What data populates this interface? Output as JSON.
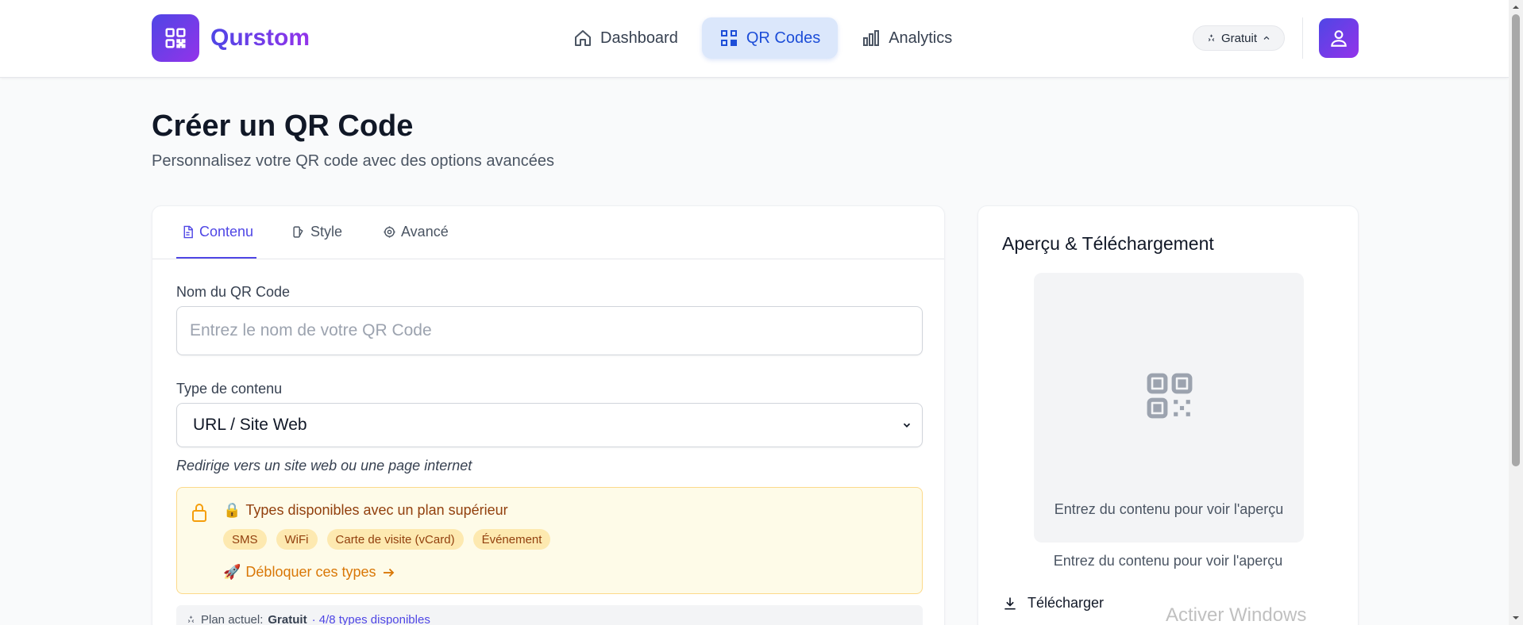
{
  "app": {
    "name": "Qurstom"
  },
  "nav": {
    "items": [
      {
        "label": "Dashboard",
        "icon": "home-icon"
      },
      {
        "label": "QR Codes",
        "icon": "qr-code-icon"
      },
      {
        "label": "Analytics",
        "icon": "bar-chart-icon"
      }
    ],
    "active": "QR Codes"
  },
  "header": {
    "plan_label": "Gratuit"
  },
  "page": {
    "title": "Créer un QR Code",
    "subtitle": "Personnalisez votre QR code avec des options avancées"
  },
  "tabs": [
    {
      "label": "Contenu",
      "icon": "file-icon"
    },
    {
      "label": "Style",
      "icon": "palette-icon"
    },
    {
      "label": "Avancé",
      "icon": "gear-icon"
    }
  ],
  "form": {
    "name_label": "Nom du QR Code",
    "name_placeholder": "Entrez le nom de votre QR Code",
    "name_value": "",
    "type_label": "Type de contenu",
    "type_value": "URL / Site Web",
    "type_helper": "Redirige vers un site web ou une page internet"
  },
  "locked": {
    "title": "Types disponibles avec un plan supérieur",
    "title_emoji": "🔒",
    "types": [
      "SMS",
      "WiFi",
      "Carte de visite (vCard)",
      "Événement"
    ],
    "unlock_label": "Débloquer ces types",
    "unlock_emoji": "🚀"
  },
  "plan_bar": {
    "prefix": "Plan actuel:",
    "plan": "Gratuit",
    "types": "· 4/8 types disponibles"
  },
  "preview": {
    "title": "Aperçu & Téléchargement",
    "empty_text": "Entrez du contenu pour voir l'aperçu",
    "caption": "Entrez du contenu pour voir l'aperçu",
    "download_label": "Télécharger"
  },
  "watermark": {
    "text": "Activer Windows"
  },
  "colors": {
    "brand_start": "#4f46e5",
    "brand_end": "#9333ea",
    "active_nav_bg": "#dbe7fb",
    "warning_bg": "#fefbe8",
    "warning_text": "#92400e"
  }
}
